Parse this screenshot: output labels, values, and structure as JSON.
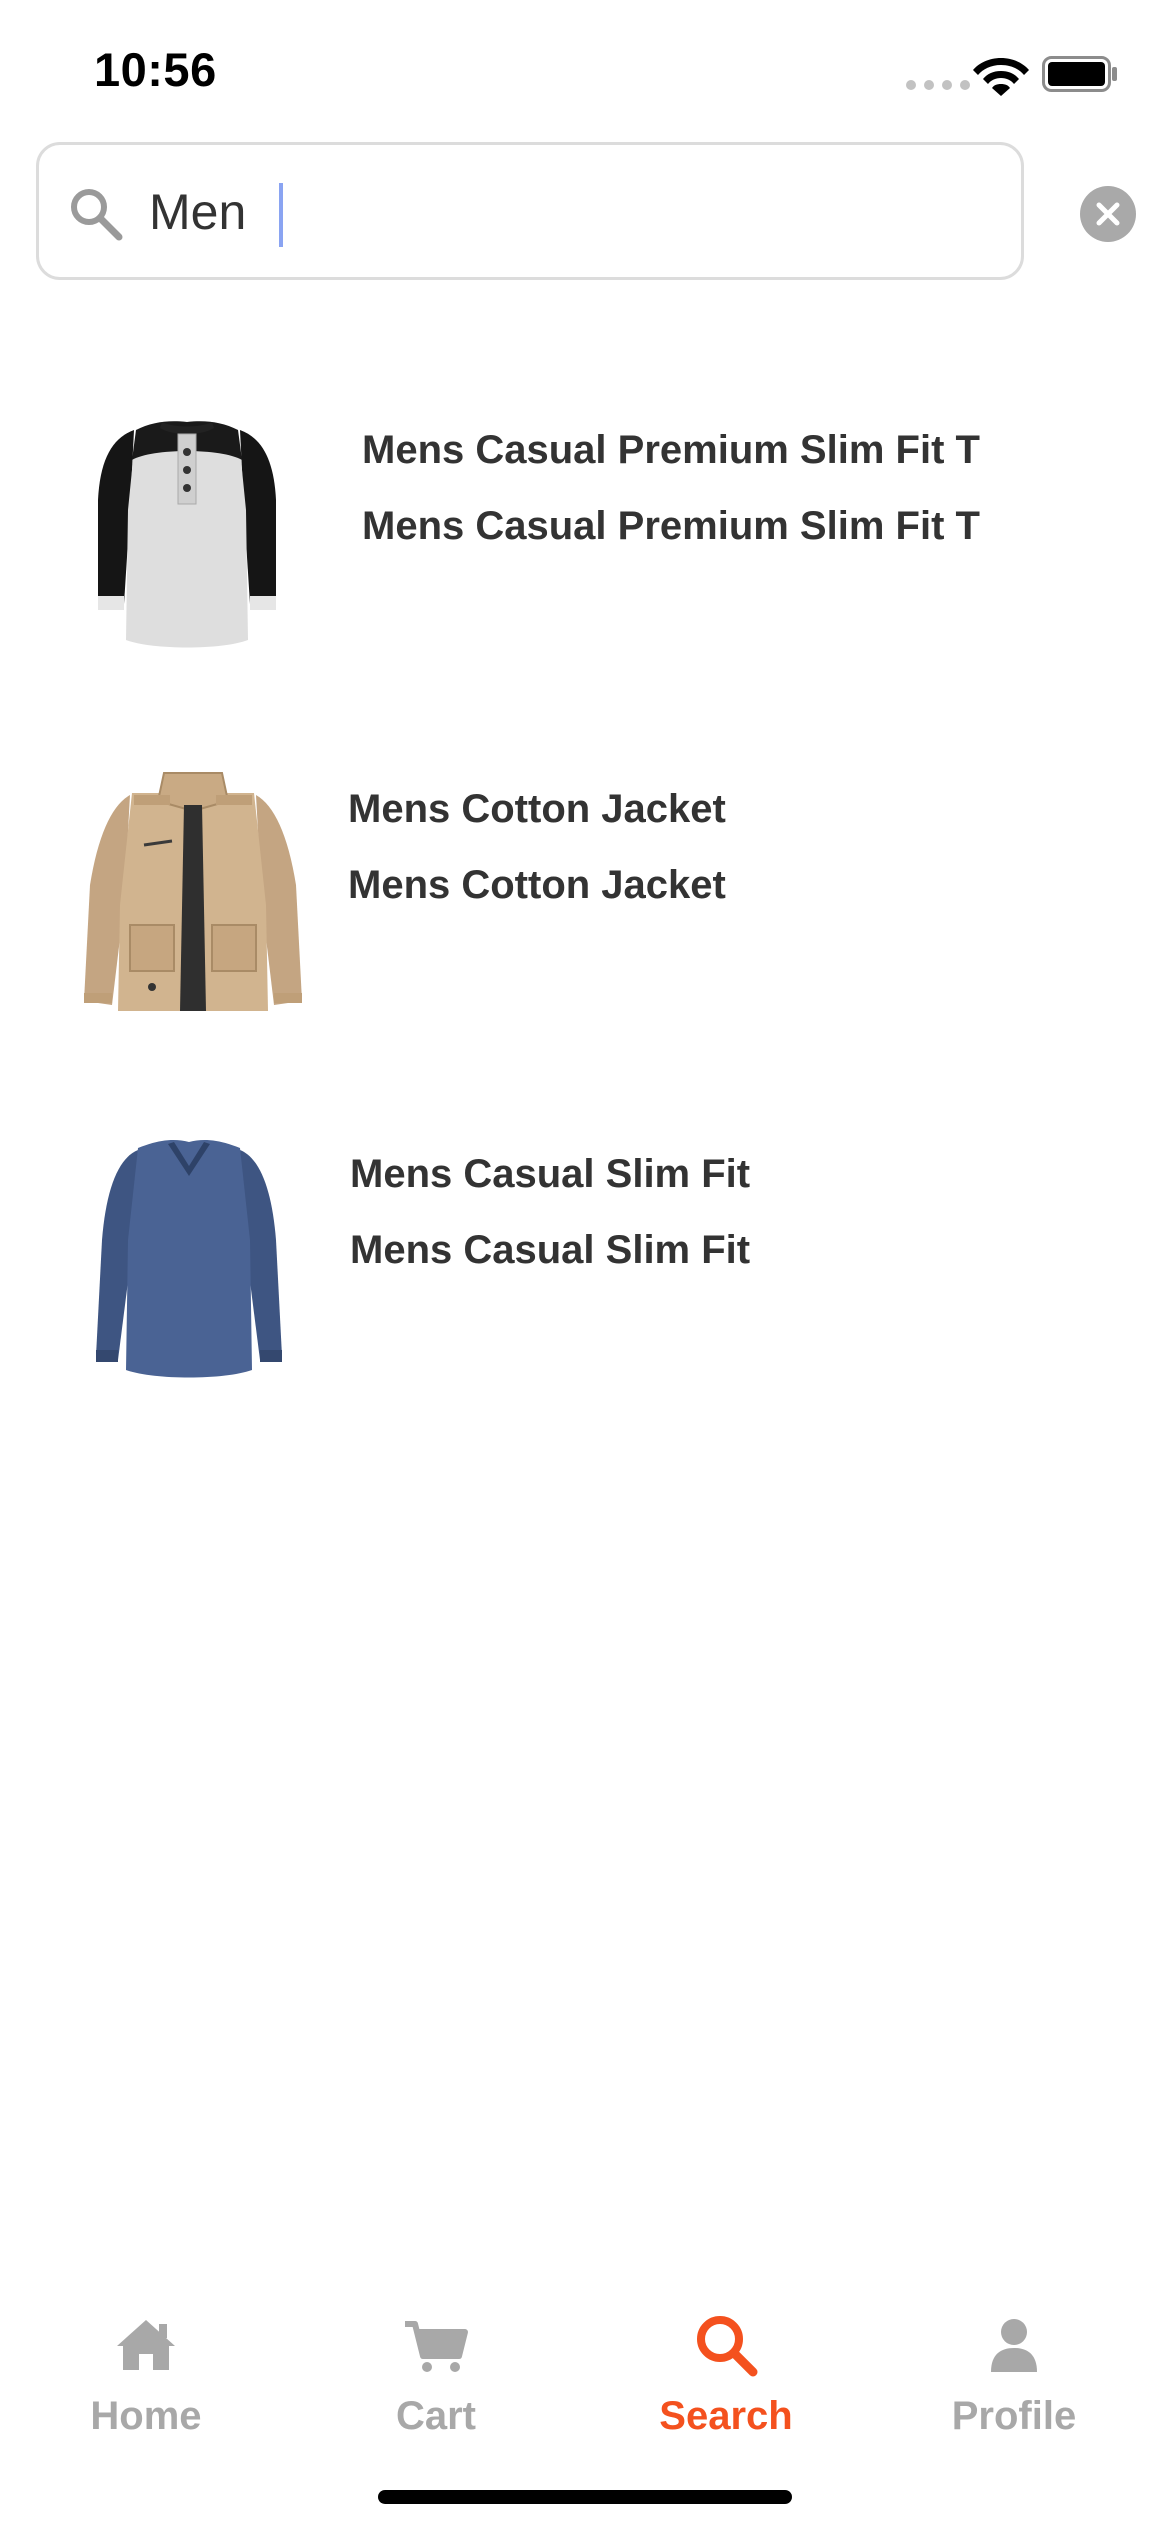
{
  "status_bar": {
    "time": "10:56"
  },
  "search": {
    "value": "Men",
    "icon": "search-icon",
    "clear_icon": "close-circle-icon"
  },
  "results": [
    {
      "title": "Mens Casual Premium Slim Fit T",
      "subtitle": "Mens Casual Premium Slim Fit T",
      "image": "henley-tshirt-image"
    },
    {
      "title": "Mens Cotton Jacket",
      "subtitle": "Mens Cotton Jacket",
      "image": "cotton-jacket-image"
    },
    {
      "title": "Mens Casual Slim Fit",
      "subtitle": "Mens Casual Slim Fit",
      "image": "longsleeve-shirt-image"
    }
  ],
  "tab_bar": {
    "tabs": [
      {
        "label": "Home",
        "icon": "home-icon",
        "active": false
      },
      {
        "label": "Cart",
        "icon": "cart-icon",
        "active": false
      },
      {
        "label": "Search",
        "icon": "search-icon",
        "active": true
      },
      {
        "label": "Profile",
        "icon": "profile-icon",
        "active": false
      }
    ]
  },
  "colors": {
    "accent": "#f4511e",
    "inactive": "#a8a8a8",
    "text": "#333333",
    "border": "#dcdcdc"
  }
}
